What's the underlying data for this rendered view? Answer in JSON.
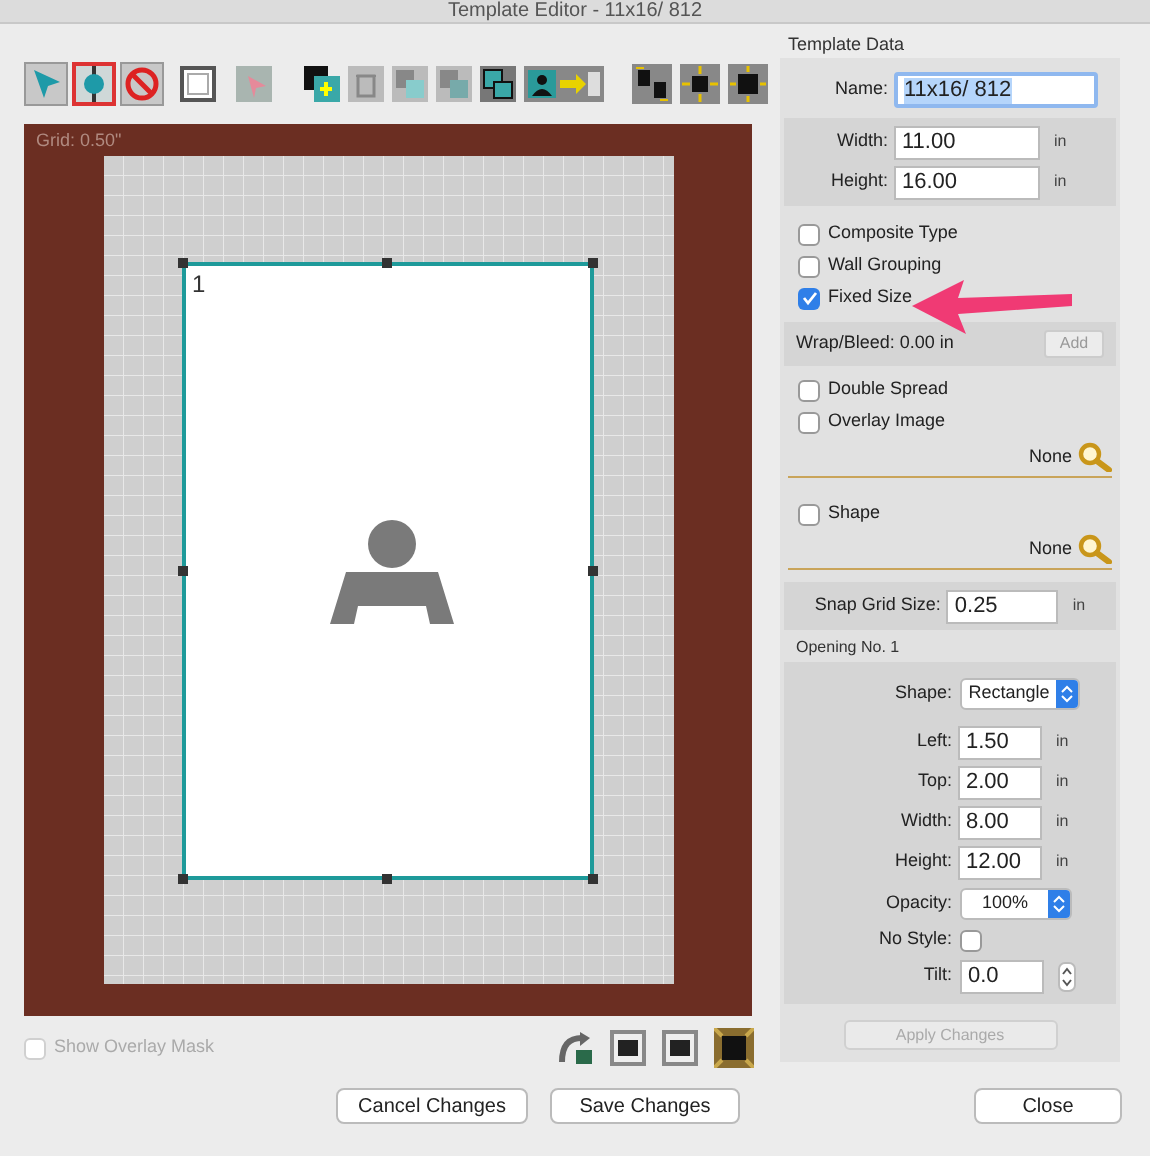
{
  "window": {
    "title": "Template Editor - 11x16/ 812"
  },
  "tools": [
    {
      "selected": false
    },
    {
      "selected": true
    },
    {
      "selected": false
    }
  ],
  "canvas": {
    "grid_label": "Grid: 0.50\"",
    "opening_number": "1"
  },
  "show_overlay_mask": {
    "label": "Show Overlay Mask",
    "checked": false,
    "disabled": true
  },
  "template_data": {
    "heading": "Template Data",
    "name": {
      "label": "Name:",
      "value": "11x16/ 812"
    },
    "size_fields": [
      {
        "label": "Width:",
        "value": "11.00",
        "unit": "in"
      },
      {
        "label": "Height:",
        "value": "16.00",
        "unit": "in"
      }
    ],
    "options": [
      {
        "label": "Composite Type",
        "checked": false
      },
      {
        "label": "Wall Grouping",
        "checked": false
      },
      {
        "label": "Fixed Size",
        "checked": true
      }
    ],
    "wrap_bleed": "Wrap/Bleed: 0.00 in",
    "add_button": "Add",
    "overlay_options": [
      {
        "label": "Double Spread",
        "checked": false
      },
      {
        "label": "Overlay Image",
        "checked": false
      }
    ],
    "overlay_image_value": "None",
    "shape_option": {
      "label": "Shape",
      "checked": false
    },
    "shape_value": "None",
    "snap": {
      "label": "Snap Grid Size:",
      "value": "0.25",
      "unit": "in"
    }
  },
  "opening": {
    "heading": "Opening No. 1",
    "shape": {
      "label": "Shape:",
      "value": "Rectangle"
    },
    "fields": [
      {
        "label": "Left:",
        "value": "1.50",
        "unit": "in"
      },
      {
        "label": "Top:",
        "value": "2.00",
        "unit": "in"
      },
      {
        "label": "Width:",
        "value": "8.00",
        "unit": "in"
      },
      {
        "label": "Height:",
        "value": "12.00",
        "unit": "in"
      }
    ],
    "opacity": {
      "label": "Opacity:",
      "value": "100%"
    },
    "no_style": {
      "label": "No Style:",
      "checked": false
    },
    "tilt": {
      "label": "Tilt:",
      "value": "0.0"
    },
    "apply_button": {
      "label": "Apply Changes",
      "disabled": true
    }
  },
  "buttons": {
    "cancel": "Cancel Changes",
    "save": "Save Changes",
    "close": "Close"
  }
}
